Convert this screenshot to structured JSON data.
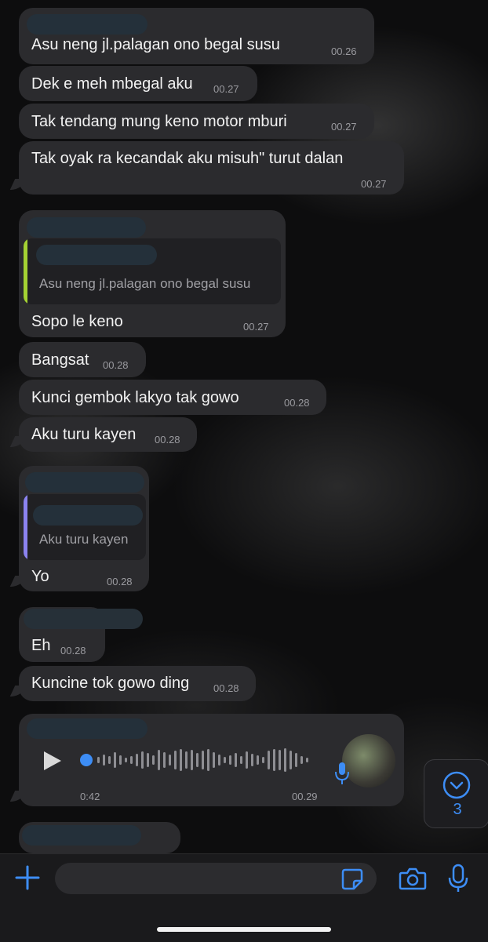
{
  "messages": [
    {
      "text": "Asu neng jl.palagan ono begal susu",
      "time": "00.26"
    },
    {
      "text": "Dek e meh mbegal aku",
      "time": "00.27"
    },
    {
      "text": "Tak tendang mung keno motor mburi",
      "time": "00.27"
    },
    {
      "text": "Tak oyak ra kecandak aku misuh\" turut dalan",
      "time": "00.27"
    },
    {
      "quote": "Asu neng jl.palagan ono begal susu",
      "text": "Sopo le keno",
      "time": "00.27"
    },
    {
      "text": "Bangsat",
      "time": "00.28"
    },
    {
      "text": "Kunci gembok lakyo tak gowo",
      "time": "00.28"
    },
    {
      "text": "Aku turu kayen",
      "time": "00.28"
    },
    {
      "quote": "Aku turu kayen",
      "text": "Yo",
      "time": "00.28"
    },
    {
      "text": "Eh",
      "time": "00.28"
    },
    {
      "text": "Kuncine tok gowo ding",
      "time": "00.28"
    }
  ],
  "voice": {
    "duration": "0:42",
    "time": "00.29",
    "icon": "play-icon"
  },
  "scroll_down": {
    "count": "3",
    "icon": "chevron-down-circle-icon"
  },
  "composer": {
    "icons": [
      "plus-icon",
      "sticker-icon",
      "camera-icon",
      "microphone-icon"
    ]
  },
  "colors": {
    "accent": "#3d8df5",
    "quote_bar_1": "#a4d233",
    "quote_bar_2": "#8b83f0",
    "bubble": "#2b2b2e"
  }
}
